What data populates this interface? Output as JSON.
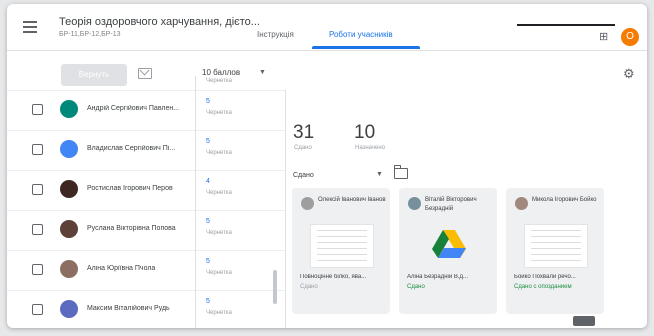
{
  "header": {
    "course_title": "Теорія оздоровчого харчування, дієто...",
    "course_sub": "БР-11,БР-12,БР-13",
    "tabs": [
      {
        "label": "Інструкція",
        "active": false
      },
      {
        "label": "Роботи учасників",
        "active": true
      }
    ],
    "avatar_letter": "О",
    "grid_icon": "apps-grid-icon",
    "accent_color": "#1a73e8",
    "avatar_color": "#f57c00"
  },
  "toolbar": {
    "return_label": "Вернуть",
    "points_value": "10 баллов",
    "mail_icon": "mail-icon",
    "settings_icon": "gear-icon"
  },
  "students": [
    {
      "name": "Андрій Сергійович Павлен...",
      "grade": "5",
      "status": "Чернетка",
      "avatar_color": "#00897b"
    },
    {
      "name": "Владислав Сергійович Пі...",
      "grade": "5",
      "status": "Чернетка",
      "avatar_color": "#4285f4"
    },
    {
      "name": "Ростислав Ігорович Перов",
      "grade": "4",
      "status": "Чернетка",
      "avatar_color": "#3e2723"
    },
    {
      "name": "Руслана Вікторівна Попова",
      "grade": "5",
      "status": "Чернетка",
      "avatar_color": "#5d4037"
    },
    {
      "name": "Аліна Юріївна Пчола",
      "grade": "5",
      "status": "Чернетка",
      "avatar_color": "#8d6e63"
    },
    {
      "name": "Максим Віталійович Рудь",
      "grade": "5",
      "status": "Чернетка",
      "avatar_color": "#5c6bc0"
    }
  ],
  "stats": [
    {
      "value": "31",
      "label": "Сдано"
    },
    {
      "value": "10",
      "label": "Назначено"
    }
  ],
  "filter": {
    "label": "Сдано"
  },
  "cards": [
    {
      "name": "Олексій Іванович Іванов",
      "file": "Повноцінне білко, ява...",
      "status": "Сдано",
      "kind": "doc",
      "avatar_color": "#9e9e9e"
    },
    {
      "name": "Віталій Вікторович Безрадній",
      "file": "Аліна Безрадній В.д...",
      "status": "Сдано",
      "kind": "drive",
      "avatar_color": "#78909c"
    },
    {
      "name": "Микола Ігорович Бойко",
      "file": "Бойко Похвали речо...",
      "status": "Сдано с опозданием",
      "kind": "doc",
      "avatar_color": "#a1887f"
    }
  ]
}
